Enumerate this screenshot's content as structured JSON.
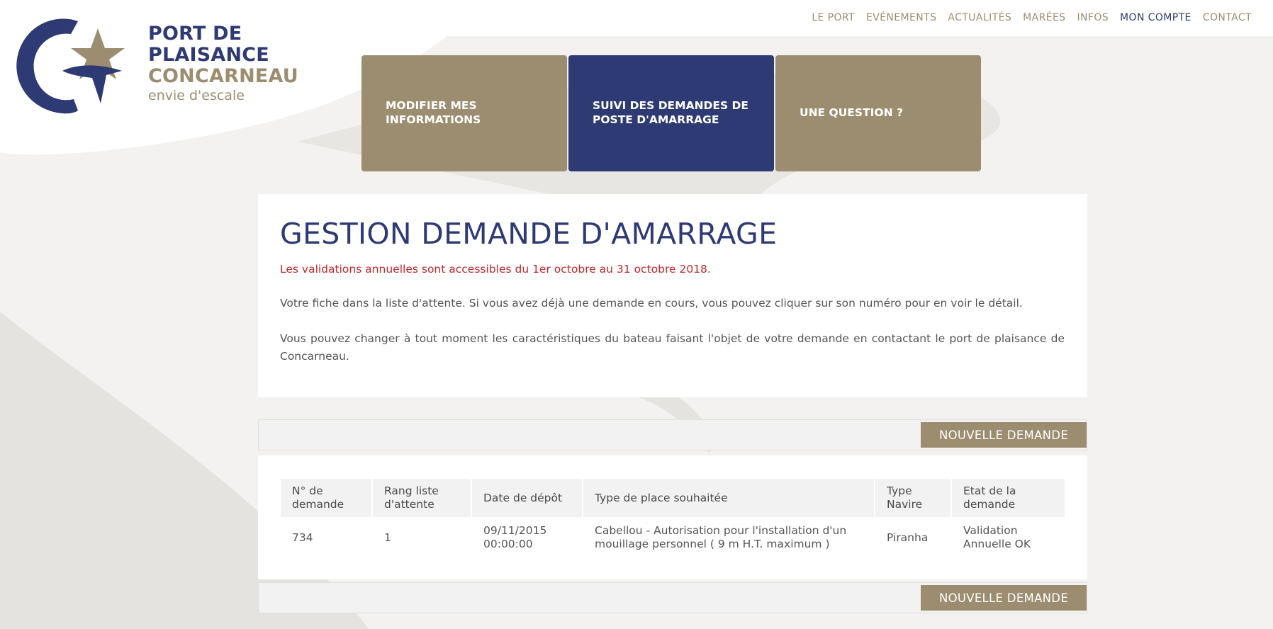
{
  "brand": {
    "line1": "PORT DE",
    "line2": "PLAISANCE",
    "line3": "CONCARNEAU",
    "tagline": "envie d'escale",
    "colors": {
      "navy": "#2e3a74",
      "gold": "#9c8d70",
      "alert_red": "#c0282d"
    }
  },
  "nav": {
    "items": [
      {
        "label": "LE PORT"
      },
      {
        "label": "EVÉNEMENTS"
      },
      {
        "label": "ACTUALITÉS"
      },
      {
        "label": "MARÉES"
      },
      {
        "label": "INFOS"
      },
      {
        "label": "MON COMPTE",
        "active": true
      },
      {
        "label": "CONTACT"
      }
    ]
  },
  "tiles": [
    {
      "label": "MODIFIER MES INFORMATIONS"
    },
    {
      "label": "SUIVI DES DEMANDES DE POSTE D'AMARRAGE",
      "active": true
    },
    {
      "label": "UNE QUESTION ?"
    }
  ],
  "main": {
    "title": "GESTION DEMANDE D'AMARRAGE",
    "notice": "Les validations annuelles sont accessibles du 1er octobre au 31 octobre 2018.",
    "para1": "Votre fiche dans la liste d'attente. Si vous avez déjà une demande en cours, vous pouvez cliquer sur son numéro pour en voir le détail.",
    "para2": "Vous pouvez changer à tout moment les caractéristiques du bateau faisant l'objet de votre demande en contactant le port de plaisance de Concarneau."
  },
  "actions": {
    "new_request_label": "NOUVELLE DEMANDE"
  },
  "table": {
    "headers": [
      "N° de demande",
      "Rang liste d'attente",
      "Date de dépôt",
      "Type de place souhaitée",
      "Type Navire",
      "Etat de la demande"
    ],
    "rows": [
      {
        "num": "734",
        "rang": "1",
        "date": "09/11/2015 00:00:00",
        "type_place": "Cabellou - Autorisation pour l'installation d'un mouillage personnel ( 9 m H.T. maximum )",
        "type_navire": "Piranha",
        "etat": "Validation Annuelle OK"
      }
    ]
  }
}
